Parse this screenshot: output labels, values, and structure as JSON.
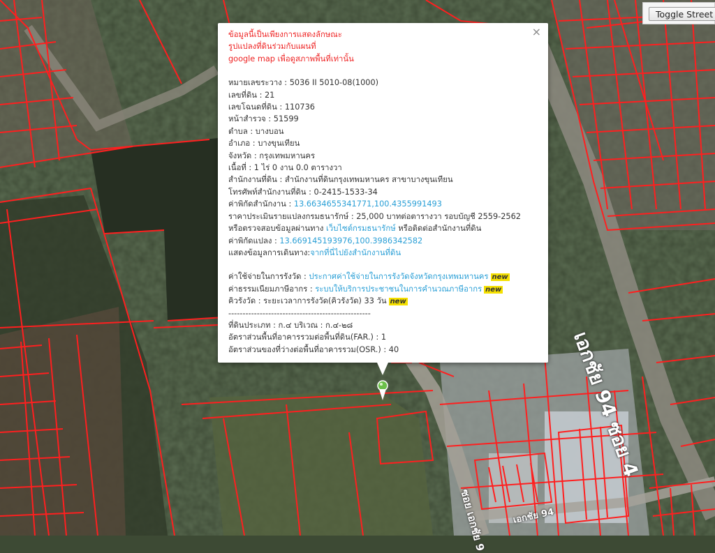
{
  "toggle_street_view": "Toggle Street V",
  "road_labels": {
    "main": "เอกชัย 94 ซอย 4",
    "side": "ซอย เอกชัย 9",
    "bottom": "เอกชัย 94"
  },
  "popup": {
    "close": "×",
    "disclaimer": [
      "ข้อมูลนี้เป็นเพียงการแสดงลักษณะ",
      "รูปแปลงที่ดินร่วมกับแผนที่",
      "google map เพื่อดูสภาพพื้นที่เท่านั้น"
    ],
    "lines": [
      "หมายเลขระวาง : 5036 II 5010-08(1000)",
      "เลขที่ดิน : 21",
      "เลขโฉนดที่ดิน : 110736",
      "หน้าสำรวจ : 51599",
      "ตำบล : บางบอน",
      "อำเภอ : บางขุนเทียน",
      "จังหวัด : กรุงเทพมหานคร",
      "เนื้อที่ : 1 ไร่ 0 งาน 0.0 ตารางวา",
      "สำนักงานที่ดิน : สำนักงานที่ดินกรุงเทพมหานคร สาขาบางขุนเทียน",
      "โทรศัพท์สำนักงานที่ดิน : 0-2415-1533-34"
    ],
    "office_coord_label": "ค่าพิกัดสำนักงาน : ",
    "office_coord": "13.6634655341771,100.4355991493",
    "appraisal": "ราคาประเมินรายแปลงกรมธนารักษ์ : 25,000 บาทต่อตารางวา รอบบัญชี 2559-2562",
    "check_prefix": "หรือตรวจสอบข้อมูลผ่านทาง ",
    "check_link": "เว็บไซต์กรมธนารักษ์",
    "check_suffix": " หรือติดต่อสำนักงานที่ดิน",
    "parcel_coord_label": "ค่าพิกัดแปลง : ",
    "parcel_coord": "13.669145193976,100.3986342582",
    "route_label": "แสดงข้อมูลการเดินทาง:",
    "route_link": "จากที่นี่ไปยังสำนักงานที่ดิน",
    "expense_label": "ค่าใช้จ่ายในการรังวัด : ",
    "expense_link": "ประกาศค่าใช้จ่ายในการรังวัดจังหวัดกรุงเทพมหานคร",
    "fee_label": "ค่าธรรมเนียมภาษีอากร : ",
    "fee_link": "ระบบให้บริการประชาชนในการคำนวณภาษีอากร",
    "queue": "คิวรังวัด : ระยะเวลาการรังวัด(คิวรังวัด) 33 วัน",
    "new_badge": "new",
    "separator": "--------------------------------------------------",
    "zoning": "ที่ดินประเภท : ก.๔ บริเวณ : ก.๔-๒๘",
    "far": "อัตราส่วนพื้นที่อาคารรวมต่อพื้นที่ดิน(FAR.) : 1",
    "osr": "อัตราส่วนของที่ว่างต่อพื้นที่อาคารรวม(OSR.) : 40"
  },
  "colors": {
    "parcel_line": "#ff1f1f",
    "disclaimer": "#e22222",
    "link": "#2a9fd6",
    "new_badge": "#f5e000",
    "pin": "#6cc04a"
  }
}
